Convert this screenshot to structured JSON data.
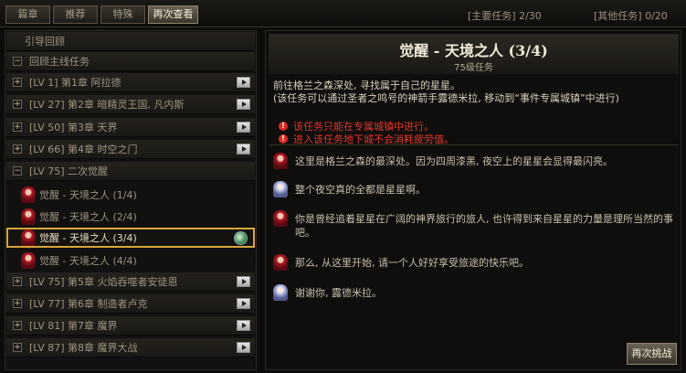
{
  "tabs": [
    "篇章",
    "推荐",
    "特殊",
    "再次查看"
  ],
  "counters": {
    "main": "[主要任务] 2/30",
    "other": "[其他任务] 0/20"
  },
  "left_list": {
    "guide_review": "引导回顾",
    "main_review": "回顾主线任务",
    "chapters": [
      {
        "label": "[LV 1] 第1章 阿拉德"
      },
      {
        "label": "[LV 27] 第2章 暗精灵王国, 凡内斯"
      },
      {
        "label": "[LV 50] 第3章 天界"
      },
      {
        "label": "[LV 66] 第4章 时空之门"
      }
    ],
    "awakening_group": "[LV 75] 二次觉醒",
    "quests": [
      {
        "label": "觉醒 - 天境之人 (1/4)"
      },
      {
        "label": "觉醒 - 天境之人 (2/4)"
      },
      {
        "label": "觉醒 - 天境之人 (3/4)"
      },
      {
        "label": "觉醒 - 天境之人 (4/4)"
      }
    ],
    "chapters_after": [
      {
        "label": "[LV 75] 第5章 火焰吞噬者安徒恩"
      },
      {
        "label": "[LV 77] 第6章 制造者卢克"
      },
      {
        "label": "[LV 81] 第7章 魔界"
      },
      {
        "label": "[LV 87] 第8章 魔界大战"
      }
    ],
    "toggle_expanded": "−",
    "toggle_collapsed": "+"
  },
  "detail": {
    "title": "觉醒 - 天境之人 (3/4)",
    "level": "75级任务",
    "desc_line1": "前往格兰之森深处, 寻找属于自己的星星。",
    "desc_line2": "(该任务可以通过圣者之鸣号的神箭手露德米拉, 移动到“事件专属城镇”中进行)",
    "warning1": "该任务只能在专属城镇中进行。",
    "warning2": "进入该任务地下城不会消耗疲劳值。",
    "warn_icon": "!",
    "dialogues": [
      {
        "text": "这里是格兰之森的最深处。因为四周漆黑, 夜空上的星星会显得最闪亮。"
      },
      {
        "text": "整个夜空真的全都是星星啊。"
      },
      {
        "text": "你是曾经追着星星在广阔的神界旅行的旅人, 也许得到来自星星的力量是理所当然的事吧。"
      },
      {
        "text": "那么, 从这里开始, 请一个人好好享受旅途的快乐吧。"
      },
      {
        "text": "谢谢你, 露德米拉。"
      }
    ],
    "challenge_button": "再次挑战"
  },
  "colors": {
    "selected_border": "#d8a53a",
    "warning": "#e0382e"
  }
}
